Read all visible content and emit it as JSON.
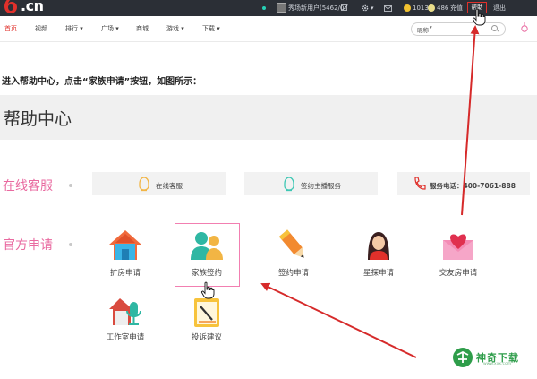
{
  "topbar": {
    "logo_suffix": ".cn",
    "account_text": "秀场新用户(5462/0)",
    "settings_chevron": "▾",
    "coins_gold": "1013",
    "coins_silver": "486",
    "recharge": "充值",
    "help": "帮助",
    "logout": "退出",
    "icons": [
      "edit-icon",
      "gear-icon",
      "mail-icon",
      "gold-coin-icon",
      "silver-coin-icon"
    ],
    "colors": {
      "bar": "#2b2f36",
      "accent": "#e0302b",
      "live": "#26d0b5"
    }
  },
  "nav": {
    "items": [
      {
        "label": "首页",
        "active": true
      },
      {
        "label": "视频"
      },
      {
        "label": "排行 ▾"
      },
      {
        "label": "广场 ▾"
      },
      {
        "label": "商城"
      },
      {
        "label": "游戏 ▾"
      },
      {
        "label": "下载 ▾"
      }
    ],
    "search_scope": "昵称",
    "search_chev": "▾"
  },
  "instruction": "进入帮助中心，点击“家族申请”按钮，如图所示：",
  "help_center": {
    "title": "帮助中心",
    "online_service": {
      "label": "在线客服",
      "buttons": [
        {
          "label": "在线客服",
          "icon": "headset-icon"
        },
        {
          "label": "签约主播服务",
          "icon": "headset-icon"
        },
        {
          "label": "服务电话：400-7061-888",
          "icon": "phone-icon"
        }
      ]
    },
    "official_apply": {
      "label": "官方申请",
      "tiles": [
        {
          "label": "扩房申请",
          "icon": "house-icon"
        },
        {
          "label": "家族签约",
          "icon": "family-icon"
        },
        {
          "label": "签约申请",
          "icon": "pencil-icon"
        },
        {
          "label": "星探申请",
          "icon": "talent-scout-icon"
        },
        {
          "label": "交友房申请",
          "icon": "love-letter-icon"
        },
        {
          "label": "工作室申请",
          "icon": "studio-mic-icon"
        },
        {
          "label": "投诉建议",
          "icon": "complaint-note-icon"
        }
      ]
    },
    "colors": {
      "section_label": "#e96aa0",
      "highlight": "#f27fb1",
      "arrow": "#d62a2a"
    }
  },
  "watermark": {
    "text": "神奇下载",
    "sub": "www.xxx.com"
  }
}
